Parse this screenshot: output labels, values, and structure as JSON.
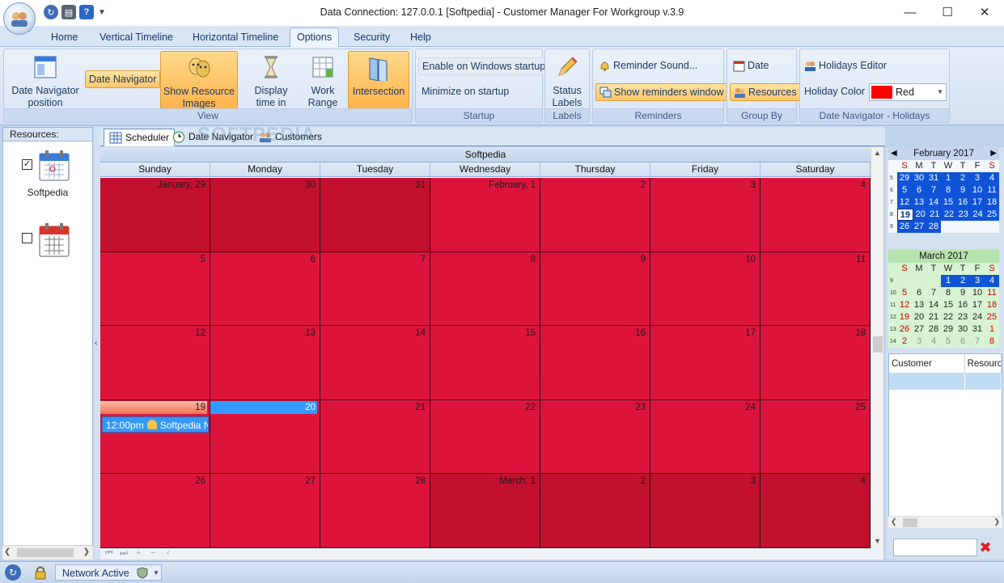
{
  "window": {
    "title": "Data Connection: 127.0.0.1 [Softpedia] - Customer Manager For Workgroup v.3.9",
    "minimize": "—",
    "maximize": "☐",
    "close": "✕"
  },
  "quick_access": {
    "icons": [
      "refresh-icon",
      "print-icon",
      "help-icon",
      "customize-dropdown-icon"
    ],
    "help_glyph": "?",
    "customize_glyph": "▼"
  },
  "ribbon_tabs": [
    "Home",
    "Vertical Timeline",
    "Horizontal Timeline",
    "Options",
    "Security",
    "Help"
  ],
  "active_tab": "Options",
  "ribbon": {
    "view": {
      "label": "View",
      "date_nav_position": "Date Navigator position",
      "date_navigator": "Date Navigator",
      "show_resource_images": "Show Resource Images",
      "display_time_in": "Display time in",
      "work_range": "Work Range",
      "intersection": "Intersection"
    },
    "startup": {
      "label": "Startup",
      "enable_windows_startup": "Enable on Windows startup",
      "minimize_on_startup": "Minimize on startup"
    },
    "labels": {
      "label": "Labels",
      "status_labels": "Status Labels"
    },
    "reminders": {
      "label": "Reminders",
      "reminder_sound": "Reminder Sound...",
      "show_reminders_window": "Show reminders window"
    },
    "group_by": {
      "label": "Group By",
      "date": "Date",
      "resources": "Resources"
    },
    "holidays": {
      "label": "Date Navigator - Holidays",
      "holidays_editor": "Holidays Editor",
      "holiday_color_label": "Holiday Color",
      "holiday_color_value": "Red",
      "holiday_color_swatch": "#ff0000"
    }
  },
  "resources_panel": {
    "header": "Resources:",
    "items": [
      {
        "name": "Softpedia",
        "checked": true,
        "check_glyph": "✓"
      },
      {
        "name": "",
        "checked": false,
        "check_glyph": ""
      }
    ]
  },
  "view_tabs": [
    "Scheduler",
    "Date Navigator",
    "Customers"
  ],
  "active_view_tab": "Scheduler",
  "watermark": "SOFTPEDIA",
  "scheduler": {
    "resource_title": "Softpedia",
    "day_headers": [
      "Sunday",
      "Monday",
      "Tuesday",
      "Wednesday",
      "Thursday",
      "Friday",
      "Saturday"
    ],
    "weeks": [
      [
        "January, 29",
        "30",
        "31",
        "February, 1",
        "2",
        "3",
        "4"
      ],
      [
        "5",
        "6",
        "7",
        "8",
        "9",
        "10",
        "11"
      ],
      [
        "12",
        "13",
        "14",
        "15",
        "16",
        "17",
        "18"
      ],
      [
        "19",
        "20",
        "21",
        "22",
        "23",
        "24",
        "25"
      ],
      [
        "26",
        "27",
        "28",
        "March, 1",
        "2",
        "3",
        "4"
      ]
    ],
    "appointment": {
      "time": "12:00pm",
      "title": "Softpedia Ne"
    },
    "colors": {
      "cell": "#dc143c",
      "cell_other_month": "#c2112f",
      "selected": "#3399ff"
    },
    "nav_glyphs": [
      "⏮",
      "⏭",
      "+",
      "−",
      "‹"
    ]
  },
  "mini_calendars": [
    {
      "title": "February 2017",
      "prev_glyph": "◀",
      "next_glyph": "▶",
      "dow": [
        "S",
        "M",
        "T",
        "W",
        "T",
        "F",
        "S"
      ],
      "weeks": [
        {
          "wk": "5",
          "days": [
            "29",
            "30",
            "31",
            "1",
            "2",
            "3",
            "4"
          ]
        },
        {
          "wk": "6",
          "days": [
            "5",
            "6",
            "7",
            "8",
            "9",
            "10",
            "11"
          ]
        },
        {
          "wk": "7",
          "days": [
            "12",
            "13",
            "14",
            "15",
            "16",
            "17",
            "18"
          ]
        },
        {
          "wk": "8",
          "days": [
            "19",
            "20",
            "21",
            "22",
            "23",
            "24",
            "25"
          ]
        },
        {
          "wk": "9",
          "days": [
            "26",
            "27",
            "28",
            "",
            "",
            "",
            ""
          ]
        }
      ]
    },
    {
      "title": "March 2017",
      "dow": [
        "S",
        "M",
        "T",
        "W",
        "T",
        "F",
        "S"
      ],
      "weeks": [
        {
          "wk": "9",
          "days": [
            "",
            "",
            "",
            "1",
            "2",
            "3",
            "4"
          ]
        },
        {
          "wk": "10",
          "days": [
            "5",
            "6",
            "7",
            "8",
            "9",
            "10",
            "11"
          ]
        },
        {
          "wk": "11",
          "days": [
            "12",
            "13",
            "14",
            "15",
            "16",
            "17",
            "18"
          ]
        },
        {
          "wk": "12",
          "days": [
            "19",
            "20",
            "21",
            "22",
            "23",
            "24",
            "25"
          ]
        },
        {
          "wk": "13",
          "days": [
            "26",
            "27",
            "28",
            "29",
            "30",
            "31",
            "1"
          ]
        },
        {
          "wk": "14",
          "days": [
            "2",
            "3",
            "4",
            "5",
            "6",
            "7",
            "8"
          ]
        }
      ]
    }
  ],
  "customer_grid": {
    "columns": [
      "Customer",
      "Resource"
    ],
    "clear_glyph": "✖"
  },
  "statusbar": {
    "network": "Network Active"
  }
}
